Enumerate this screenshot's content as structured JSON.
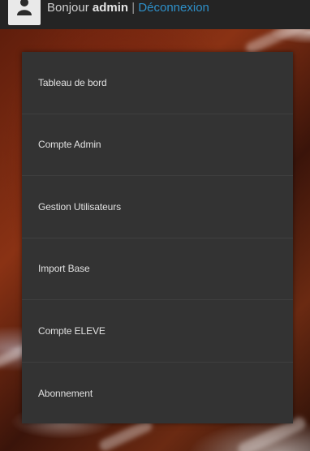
{
  "header": {
    "greeting": "Bonjour",
    "username": "admin",
    "separator": "|",
    "logout_label": "Déconnexion"
  },
  "menu": {
    "items": [
      {
        "label": "Tableau de bord"
      },
      {
        "label": "Compte Admin"
      },
      {
        "label": "Gestion Utilisateurs"
      },
      {
        "label": "Import Base"
      },
      {
        "label": "Compte ELEVE"
      },
      {
        "label": "Abonnement"
      }
    ]
  },
  "colors": {
    "menu_bg": "#333333",
    "topbar_bg": "#242424",
    "link": "#2e90c9"
  }
}
